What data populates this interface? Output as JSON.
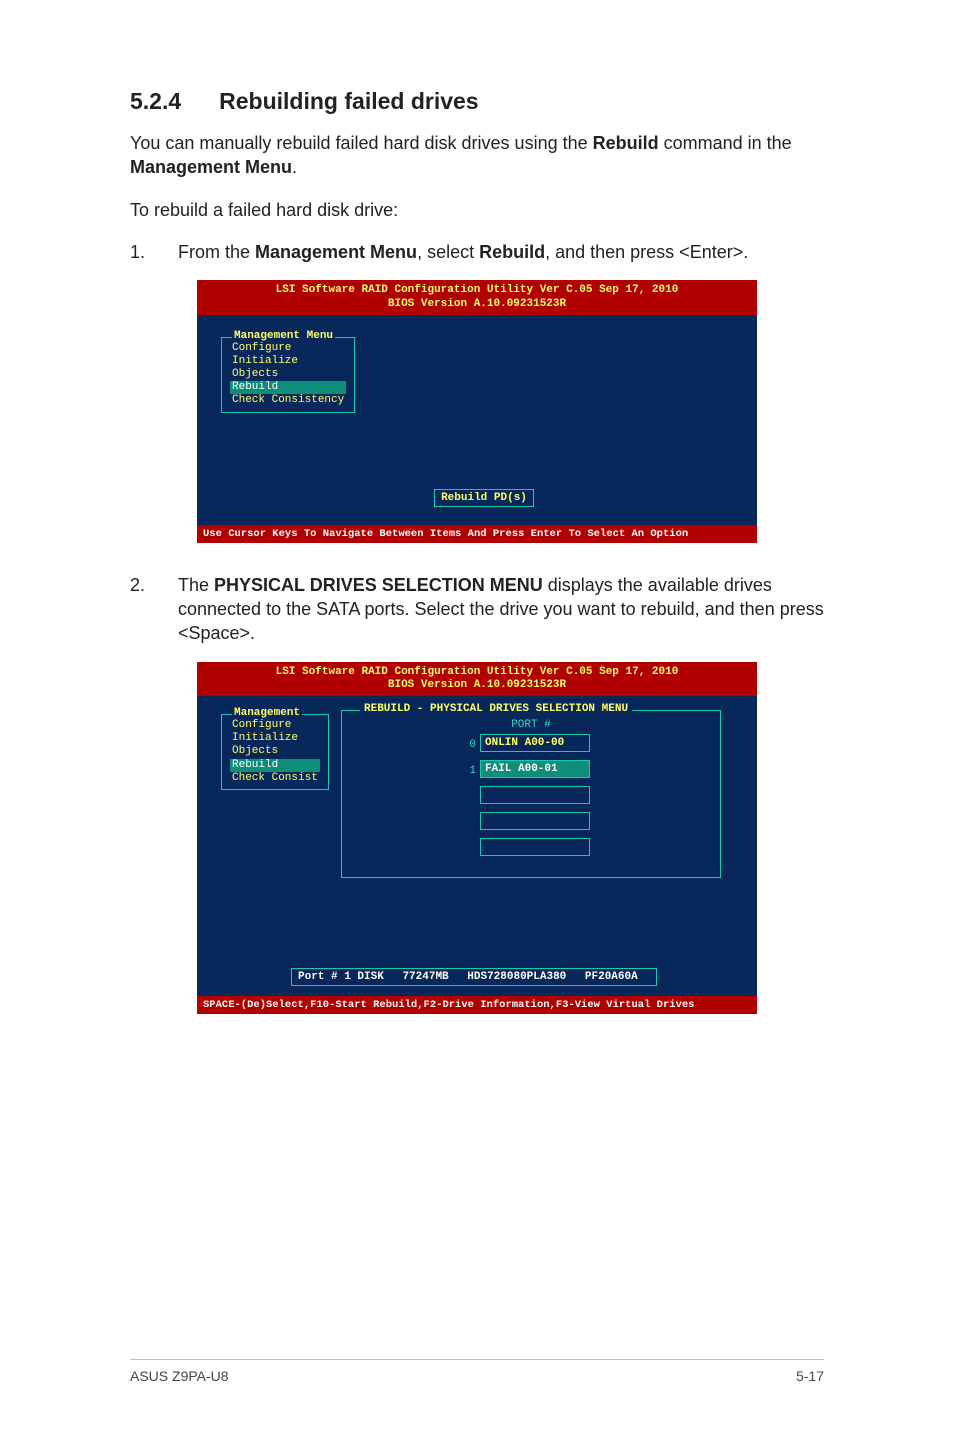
{
  "heading": {
    "number": "5.2.4",
    "title": "Rebuilding failed drives"
  },
  "intro": {
    "pre": "You can manually rebuild failed hard disk drives using the ",
    "bold1": "Rebuild",
    "mid": " command in the ",
    "bold2": "Management Menu",
    "post": "."
  },
  "intro2": "To rebuild a failed hard disk drive:",
  "step1": {
    "num": "1.",
    "pre": "From the ",
    "bold1": "Management Menu",
    "mid": ", select ",
    "bold2": "Rebuild",
    "post": ", and then press <Enter>."
  },
  "bios_header_line1": "LSI Software RAID Configuration Utility Ver C.05 Sep 17, 2010",
  "bios_header_line2": "BIOS Version   A.10.09231523R",
  "menu1": {
    "title": "Management Menu",
    "items": [
      "Configure",
      "Initialize",
      "Objects",
      "Rebuild",
      "Check Consistency"
    ],
    "selected_index": 3
  },
  "hint1": "Rebuild PD(s)",
  "status1": "Use Cursor Keys To Navigate Between Items And Press Enter To Select An Option",
  "step2": {
    "num": "2.",
    "pre": "The ",
    "bold1": "PHYSICAL DRIVES SELECTION MENU",
    "post": " displays the available drives connected to the SATA ports. Select the drive you want to rebuild, and then press <Space>."
  },
  "menu2": {
    "title": "Management",
    "items": [
      "Configure",
      "Initialize",
      "Objects",
      "Rebuild",
      "Check Consist"
    ],
    "selected_index": 3
  },
  "rebuild_title": "REBUILD - PHYSICAL DRIVES SELECTION MENU",
  "port_header": "PORT #",
  "ports": [
    {
      "idx": "0",
      "label": "ONLIN A00-00",
      "selected": false
    },
    {
      "idx": "1",
      "label": "FAIL  A00-01",
      "selected": true
    }
  ],
  "port_info": {
    "port": "Port # 1 DISK",
    "size": "77247MB",
    "model": "HDS728080PLA380",
    "fw": "PF20A60A"
  },
  "status2": "SPACE-(De)Select,F10-Start Rebuild,F2-Drive Information,F3-View Virtual Drives",
  "footer": {
    "left": "ASUS Z9PA-U8",
    "right": "5-17"
  }
}
